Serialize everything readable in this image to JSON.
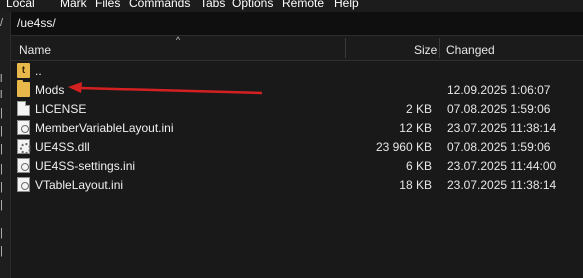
{
  "menubar": {
    "items": [
      "Local",
      "Mark",
      "Files",
      "Commands",
      "Tabs",
      "Options",
      "Remote",
      "Help"
    ]
  },
  "pathbar": {
    "path": "/ue4ss/"
  },
  "columns": {
    "name": "Name",
    "size": "Size",
    "changed": "Changed"
  },
  "rows": [
    {
      "name": "..",
      "size": "",
      "changed": "",
      "icon": "parent-directory-icon"
    },
    {
      "name": "Mods",
      "size": "",
      "changed": "12.09.2025 1:06:07",
      "icon": "folder-icon"
    },
    {
      "name": "LICENSE",
      "size": "2 KB",
      "changed": "07.08.2025 1:59:06",
      "icon": "file-icon"
    },
    {
      "name": "MemberVariableLayout.ini",
      "size": "12 KB",
      "changed": "23.07.2025 11:38:14",
      "icon": "ini-file-icon"
    },
    {
      "name": "UE4SS.dll",
      "size": "23 960 KB",
      "changed": "07.08.2025 1:59:06",
      "icon": "dll-file-icon"
    },
    {
      "name": "UE4SS-settings.ini",
      "size": "6 KB",
      "changed": "23.07.2025 11:44:00",
      "icon": "ini-file-icon"
    },
    {
      "name": "VTableLayout.ini",
      "size": "18 KB",
      "changed": "23.07.2025 11:38:14",
      "icon": "ini-file-icon"
    }
  ],
  "annotation": {
    "color": "#d42020",
    "points_to": "Mods"
  }
}
